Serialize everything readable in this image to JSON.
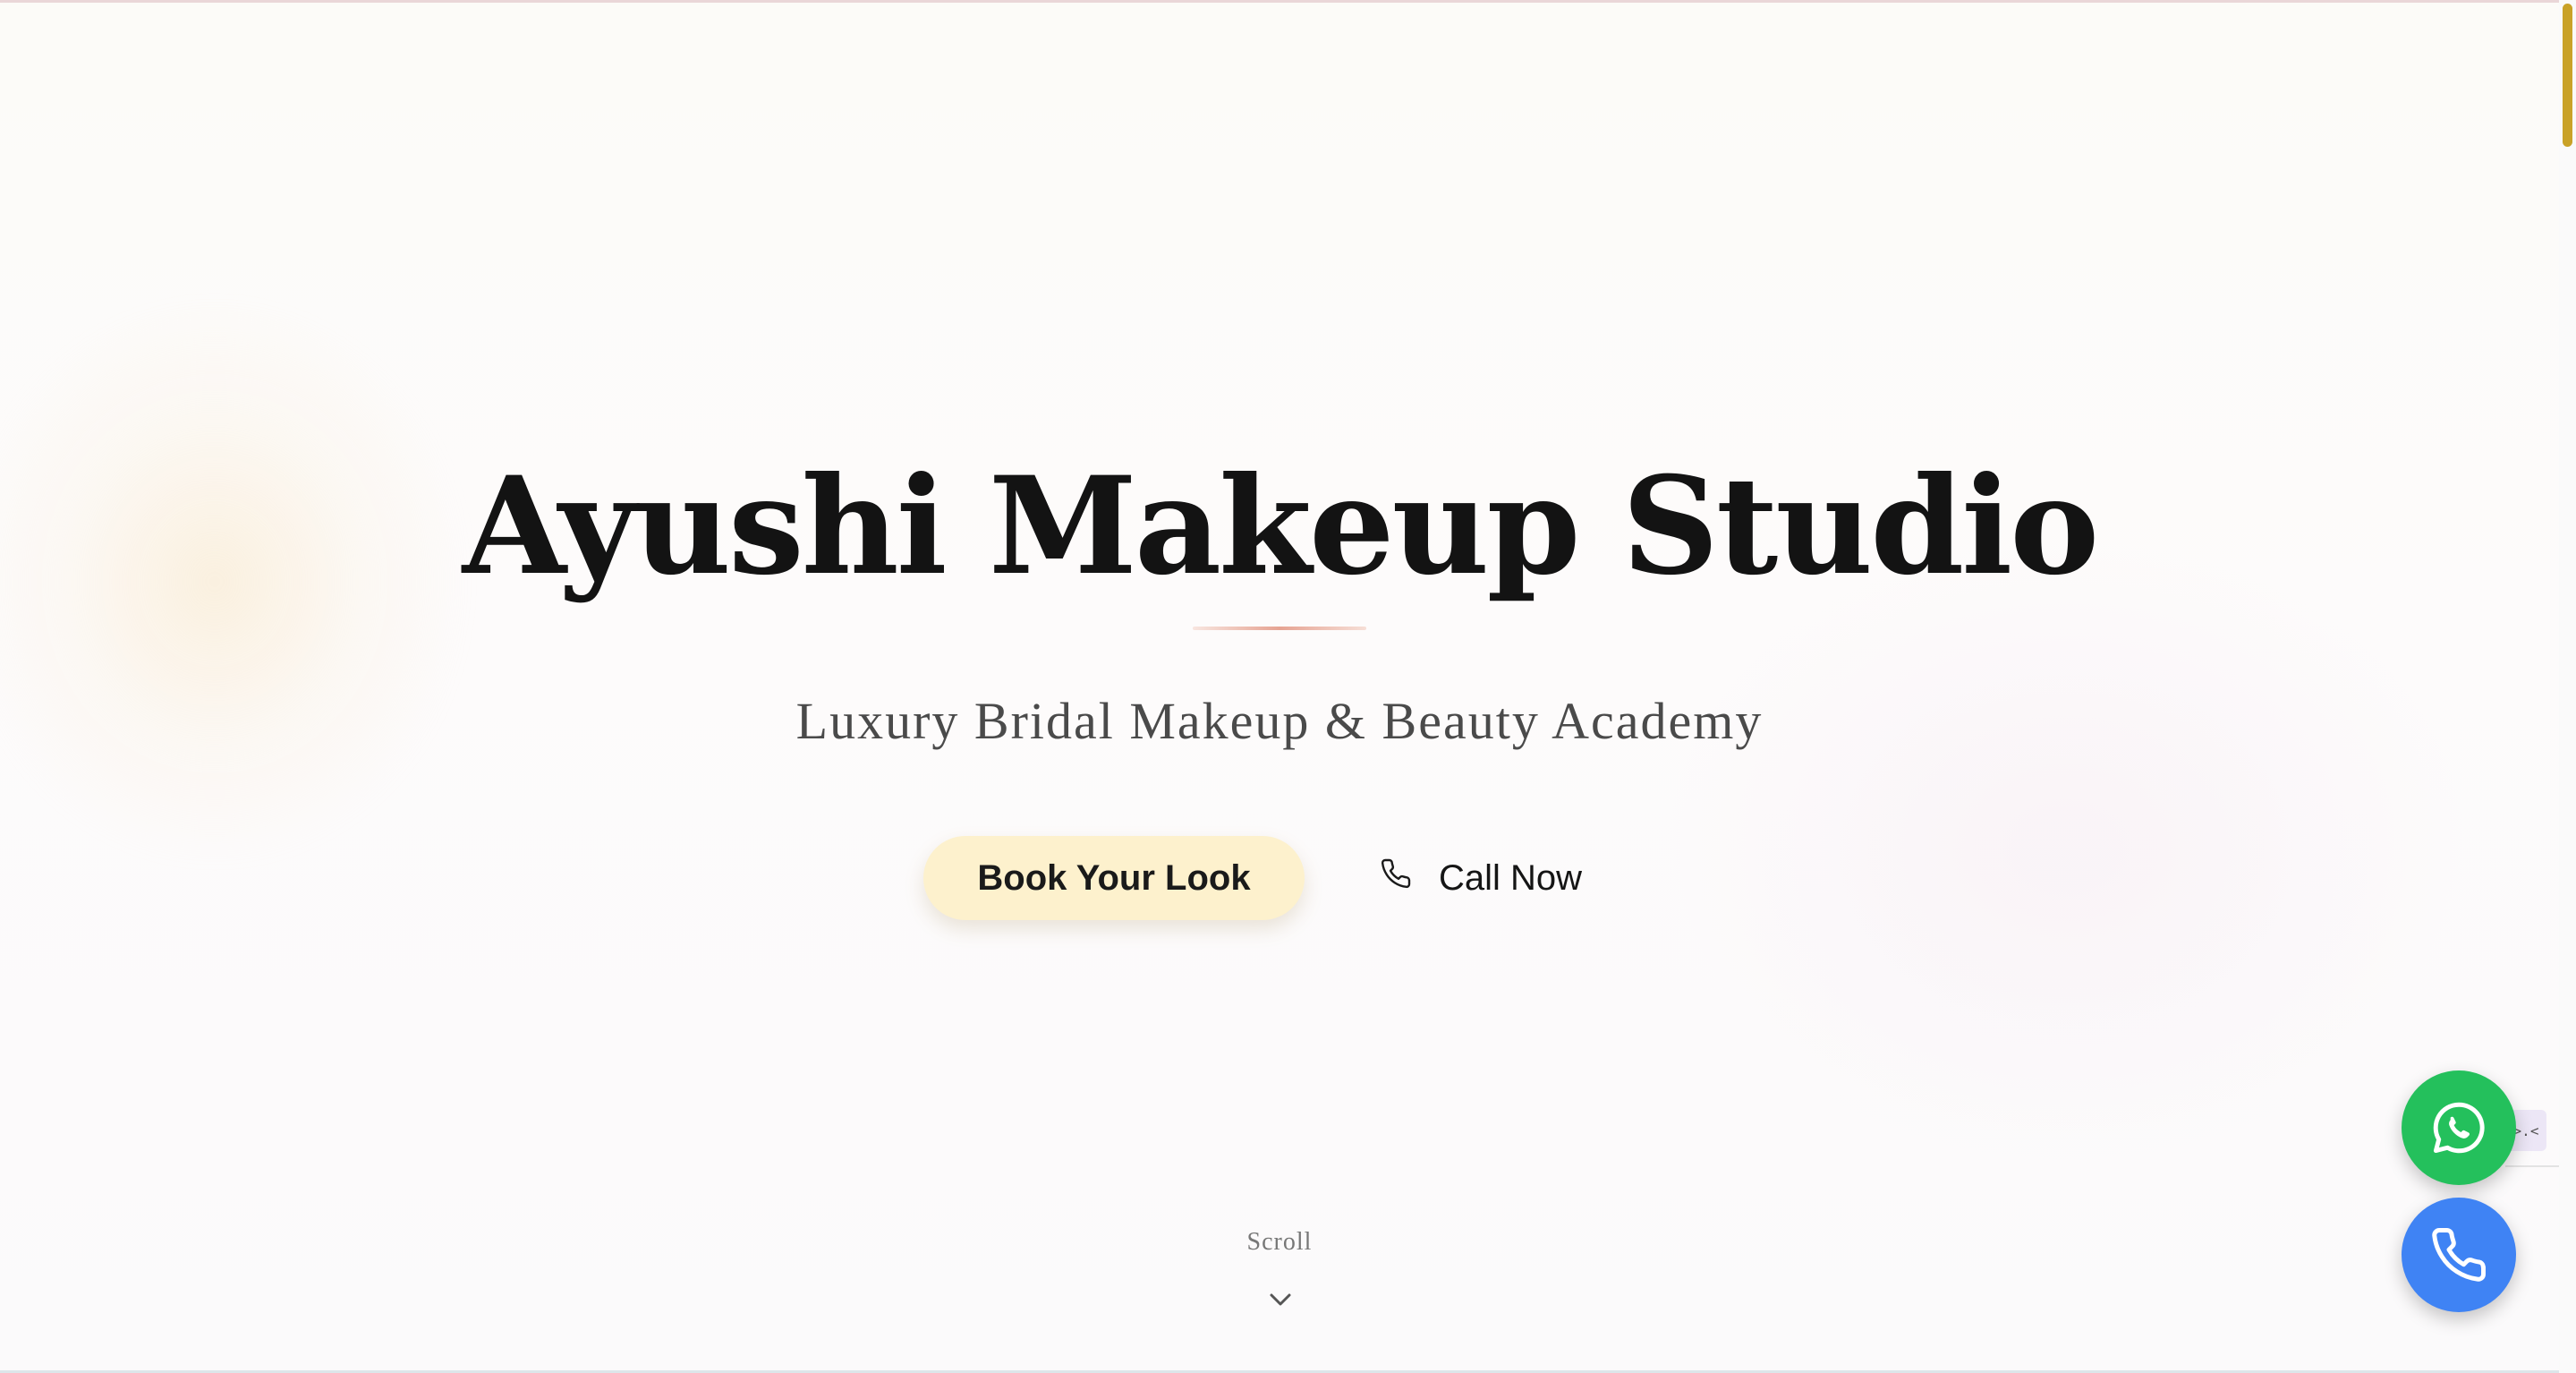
{
  "hero": {
    "title": "Ayushi Makeup Studio",
    "subtitle": "Luxury Bridal Makeup & Beauty Academy",
    "book_label": "Book Your Look",
    "call_label": "Call Now",
    "scroll_label": "Scroll"
  },
  "floating_actions": {
    "whatsapp_icon": "whatsapp-icon",
    "phone_icon": "phone-icon"
  },
  "side_widget": {
    "label": ">.<"
  },
  "colors": {
    "accent_gold": "#c9a227",
    "button_cream": "#fdf1cd",
    "whatsapp_green": "#24c05c",
    "phone_blue": "#3f83f4",
    "divider_rose": "#e6a392"
  }
}
